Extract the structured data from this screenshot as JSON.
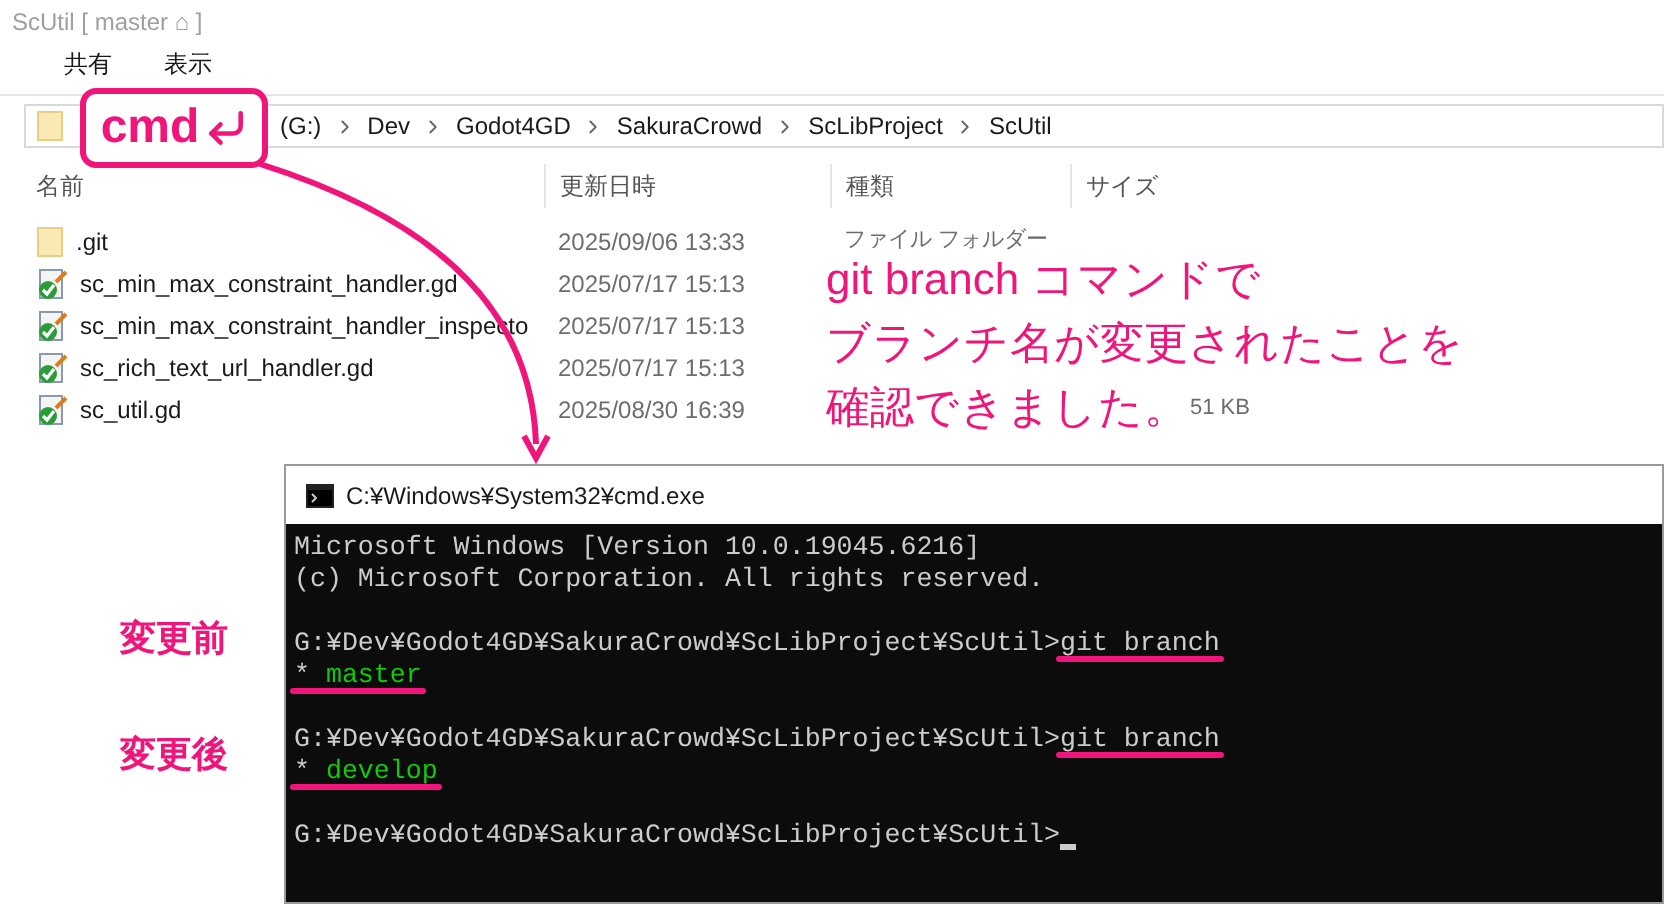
{
  "window": {
    "title": "ScUtil [ master ⌂ ]"
  },
  "ribbon_tabs": [
    {
      "label": "共有",
      "selected": false
    },
    {
      "label": "表示",
      "selected": false
    }
  ],
  "address_bar": {
    "crumbs": [
      "(G:)",
      "Dev",
      "Godot4GD",
      "SakuraCrowd",
      "ScLibProject",
      "ScUtil"
    ]
  },
  "callout": {
    "text": "cmd"
  },
  "file_list": {
    "columns": [
      "名前",
      "更新日時",
      "種類",
      "サイズ"
    ],
    "rows": [
      {
        "kind": "folder",
        "name": ".git",
        "modified": "2025/09/06 13:33",
        "type": "ファイル フォルダー"
      },
      {
        "kind": "script",
        "name": "sc_min_max_constraint_handler.gd",
        "modified": "2025/07/17 15:13"
      },
      {
        "kind": "script",
        "name": "sc_min_max_constraint_handler_inspecto",
        "modified": "2025/07/17 15:13"
      },
      {
        "kind": "script",
        "name": "sc_rich_text_url_handler.gd",
        "modified": "2025/07/17 15:13"
      },
      {
        "kind": "script",
        "name": "sc_util.gd",
        "modified": "2025/08/30 16:39",
        "size": "51 KB"
      }
    ]
  },
  "cmd_window": {
    "title": "C:¥Windows¥System32¥cmd.exe",
    "lines": [
      {
        "kind": "output",
        "text": "Microsoft Windows [Version 10.0.19045.6216]"
      },
      {
        "kind": "output",
        "text": "(c) Microsoft Corporation. All rights reserved."
      },
      {
        "kind": "blank"
      },
      {
        "kind": "prompt",
        "text": "G:¥Dev¥Godot4GD¥SakuraCrowd¥ScLibProject¥ScUtil>",
        "command": "git branch",
        "underlined": true
      },
      {
        "kind": "branch",
        "marker": "*",
        "text": "master",
        "underlined": true
      },
      {
        "kind": "blank"
      },
      {
        "kind": "prompt",
        "text": "G:¥Dev¥Godot4GD¥SakuraCrowd¥ScLibProject¥ScUtil>",
        "command": "git branch",
        "underlined": true
      },
      {
        "kind": "branch",
        "marker": "*",
        "text": "develop",
        "underlined": true
      },
      {
        "kind": "blank"
      },
      {
        "kind": "prompt",
        "text": "G:¥Dev¥Godot4GD¥SakuraCrowd¥ScLibProject¥ScUtil>",
        "cursor": true
      }
    ]
  },
  "annotations": {
    "message": [
      "git branch コマンドで",
      "ブランチ名が変更されたことを",
      "確認できました。"
    ],
    "labels": [
      "変更前",
      "変更後"
    ]
  }
}
